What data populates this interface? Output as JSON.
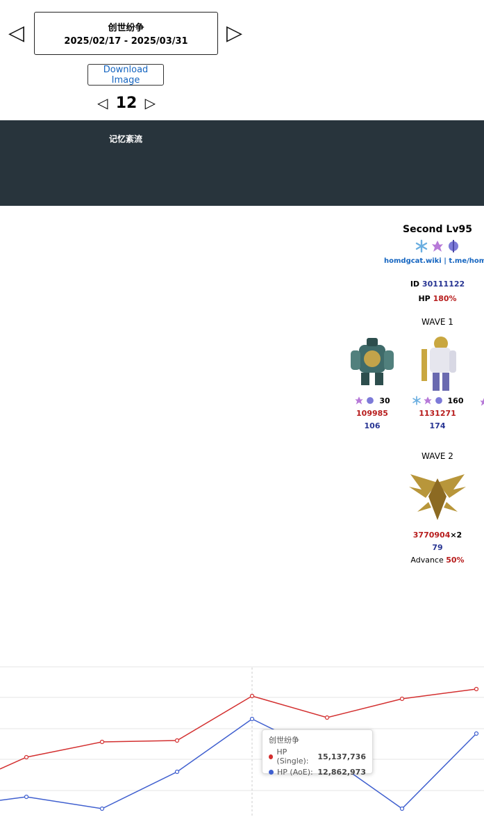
{
  "header": {
    "title": "创世纷争",
    "date_range": "2025/02/17 - 2025/03/31",
    "prev_arrow": "◁",
    "next_arrow": "▷"
  },
  "download": {
    "label": "Download Image"
  },
  "floor": {
    "number": "12",
    "prev": "◁",
    "next": "▷"
  },
  "band": {
    "label": "记忆紊流"
  },
  "side": {
    "title": "Second Lv95",
    "links": "homdgcat.wiki | t.me/homdgc",
    "id_label": "ID",
    "id_value": "30111122",
    "hp_label": "HP",
    "hp_value": "180%",
    "wave1_label": "WAVE 1",
    "wave2_label": "WAVE 2",
    "enemies_wave1": [
      {
        "level": "30",
        "hp": "109985",
        "speed": "106",
        "icon": "robot-enemy-icon"
      },
      {
        "level": "160",
        "hp": "1131271",
        "speed": "174",
        "icon": "knight-enemy-icon"
      }
    ],
    "enemy_wave2": {
      "hp": "3770904",
      "mult": "×2",
      "speed": "79",
      "advance_label": "Advance",
      "advance_value": "50%"
    }
  },
  "colors": {
    "dark_band": "#28343c",
    "single": "#d32f2f",
    "aoe": "#3f5fcf"
  },
  "tooltip": {
    "title": "创世纷争",
    "single_label": "HP (Single):",
    "single_value": "15,137,736",
    "aoe_label": "HP (AoE):",
    "aoe_value": "12,862,973"
  },
  "chart_data": {
    "type": "line",
    "series": [
      {
        "name": "HP (Single)",
        "values": [
          null,
          null,
          null,
          null,
          15137736,
          null,
          null
        ]
      },
      {
        "name": "HP (AoE)",
        "values": [
          null,
          null,
          null,
          null,
          12862973,
          null,
          null
        ]
      }
    ],
    "x_count": 7
  }
}
